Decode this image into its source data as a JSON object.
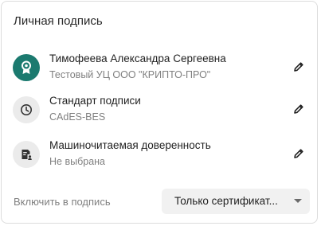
{
  "card": {
    "title": "Личная подпись"
  },
  "rows": [
    {
      "primary": "Тимофеева Александра Сергеевна",
      "secondary": "Тестовый УЦ ООО \"КРИПТО-ПРО\"",
      "icon": "certificate-icon",
      "icon_bg": "#1b7a6f"
    },
    {
      "primary": "Стандарт подписи",
      "secondary": "CAdES-BES",
      "icon": "clock-icon",
      "icon_bg": "#ebebeb"
    },
    {
      "primary": "Машиночитаемая доверенность",
      "secondary": "Не выбрана",
      "icon": "power-of-attorney-icon",
      "icon_bg": "#ebebeb"
    }
  ],
  "footer": {
    "label": "Включить в подпись",
    "select_value": "Только сертификат..."
  }
}
